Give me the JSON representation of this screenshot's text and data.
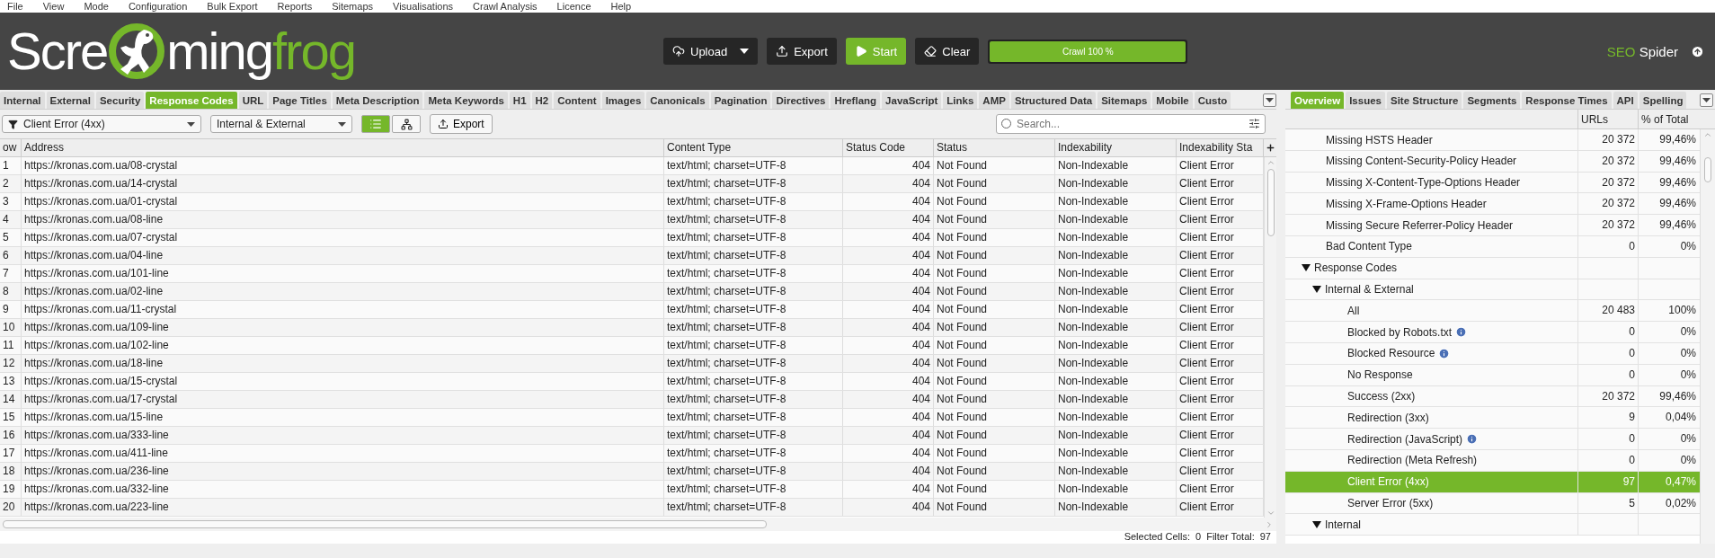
{
  "menu": [
    "File",
    "View",
    "Mode",
    "Configuration",
    "Bulk Export",
    "Reports",
    "Sitemaps",
    "Visualisations",
    "Crawl Analysis",
    "Licence",
    "Help"
  ],
  "logo": {
    "before": "Scre",
    "middle": "ming",
    "after": "frog"
  },
  "header_buttons": [
    {
      "kind": "upload",
      "label": "Upload"
    },
    {
      "kind": "export",
      "label": "Export"
    },
    {
      "kind": "start",
      "label": "Start"
    },
    {
      "kind": "clear",
      "label": "Clear"
    }
  ],
  "progress": {
    "label": "Crawl 100 %",
    "level": 1
  },
  "brand": {
    "accent": "SEO",
    "name": "Spider"
  },
  "tabs": [
    {
      "label": "Internal",
      "selected": false
    },
    {
      "label": "External",
      "selected": false
    },
    {
      "label": "Security",
      "selected": false
    },
    {
      "label": "Response Codes",
      "selected": true
    },
    {
      "label": "URL",
      "selected": false
    },
    {
      "label": "Page Titles",
      "selected": false
    },
    {
      "label": "Meta Description",
      "selected": false
    },
    {
      "label": "Meta Keywords",
      "selected": false
    },
    {
      "label": "H1",
      "selected": false
    },
    {
      "label": "H2",
      "selected": false
    },
    {
      "label": "Content",
      "selected": false
    },
    {
      "label": "Images",
      "selected": false
    },
    {
      "label": "Canonicals",
      "selected": false
    },
    {
      "label": "Pagination",
      "selected": false
    },
    {
      "label": "Directives",
      "selected": false
    },
    {
      "label": "Hreflang",
      "selected": false
    },
    {
      "label": "JavaScript",
      "selected": false
    },
    {
      "label": "Links",
      "selected": false
    },
    {
      "label": "AMP",
      "selected": false
    },
    {
      "label": "Structured Data",
      "selected": false
    },
    {
      "label": "Sitemaps",
      "selected": false
    },
    {
      "label": "Mobile",
      "selected": false
    },
    {
      "label": "Custo",
      "selected": false
    }
  ],
  "toolbar": {
    "filter": "Client Error (4xx)",
    "scope": "Internal & External",
    "views": [
      {
        "kind": "list",
        "selected": true
      },
      {
        "kind": "tree",
        "selected": false
      }
    ],
    "export": "Export",
    "search_placeholder": "Search..."
  },
  "table": {
    "columns": [
      "ow",
      "Address",
      "Content Type",
      "Status Code",
      "Status",
      "Indexability",
      "Indexability Sta"
    ],
    "rows": [
      {
        "row": "1",
        "address": "https://kronas.com.ua/08-crystal",
        "content_type": "text/html; charset=UTF-8",
        "status_code": "404",
        "status": "Not Found",
        "indexability": "Non-Indexable",
        "indexability_status": "Client Error"
      },
      {
        "row": "2",
        "address": "https://kronas.com.ua/14-crystal",
        "content_type": "text/html; charset=UTF-8",
        "status_code": "404",
        "status": "Not Found",
        "indexability": "Non-Indexable",
        "indexability_status": "Client Error"
      },
      {
        "row": "3",
        "address": "https://kronas.com.ua/01-crystal",
        "content_type": "text/html; charset=UTF-8",
        "status_code": "404",
        "status": "Not Found",
        "indexability": "Non-Indexable",
        "indexability_status": "Client Error"
      },
      {
        "row": "4",
        "address": "https://kronas.com.ua/08-line",
        "content_type": "text/html; charset=UTF-8",
        "status_code": "404",
        "status": "Not Found",
        "indexability": "Non-Indexable",
        "indexability_status": "Client Error"
      },
      {
        "row": "5",
        "address": "https://kronas.com.ua/07-crystal",
        "content_type": "text/html; charset=UTF-8",
        "status_code": "404",
        "status": "Not Found",
        "indexability": "Non-Indexable",
        "indexability_status": "Client Error"
      },
      {
        "row": "6",
        "address": "https://kronas.com.ua/04-line",
        "content_type": "text/html; charset=UTF-8",
        "status_code": "404",
        "status": "Not Found",
        "indexability": "Non-Indexable",
        "indexability_status": "Client Error"
      },
      {
        "row": "7",
        "address": "https://kronas.com.ua/101-line",
        "content_type": "text/html; charset=UTF-8",
        "status_code": "404",
        "status": "Not Found",
        "indexability": "Non-Indexable",
        "indexability_status": "Client Error"
      },
      {
        "row": "8",
        "address": "https://kronas.com.ua/02-line",
        "content_type": "text/html; charset=UTF-8",
        "status_code": "404",
        "status": "Not Found",
        "indexability": "Non-Indexable",
        "indexability_status": "Client Error"
      },
      {
        "row": "9",
        "address": "https://kronas.com.ua/11-crystal",
        "content_type": "text/html; charset=UTF-8",
        "status_code": "404",
        "status": "Not Found",
        "indexability": "Non-Indexable",
        "indexability_status": "Client Error"
      },
      {
        "row": "10",
        "address": "https://kronas.com.ua/109-line",
        "content_type": "text/html; charset=UTF-8",
        "status_code": "404",
        "status": "Not Found",
        "indexability": "Non-Indexable",
        "indexability_status": "Client Error"
      },
      {
        "row": "11",
        "address": "https://kronas.com.ua/102-line",
        "content_type": "text/html; charset=UTF-8",
        "status_code": "404",
        "status": "Not Found",
        "indexability": "Non-Indexable",
        "indexability_status": "Client Error"
      },
      {
        "row": "12",
        "address": "https://kronas.com.ua/18-line",
        "content_type": "text/html; charset=UTF-8",
        "status_code": "404",
        "status": "Not Found",
        "indexability": "Non-Indexable",
        "indexability_status": "Client Error"
      },
      {
        "row": "13",
        "address": "https://kronas.com.ua/15-crystal",
        "content_type": "text/html; charset=UTF-8",
        "status_code": "404",
        "status": "Not Found",
        "indexability": "Non-Indexable",
        "indexability_status": "Client Error"
      },
      {
        "row": "14",
        "address": "https://kronas.com.ua/17-crystal",
        "content_type": "text/html; charset=UTF-8",
        "status_code": "404",
        "status": "Not Found",
        "indexability": "Non-Indexable",
        "indexability_status": "Client Error"
      },
      {
        "row": "15",
        "address": "https://kronas.com.ua/15-line",
        "content_type": "text/html; charset=UTF-8",
        "status_code": "404",
        "status": "Not Found",
        "indexability": "Non-Indexable",
        "indexability_status": "Client Error"
      },
      {
        "row": "16",
        "address": "https://kronas.com.ua/333-line",
        "content_type": "text/html; charset=UTF-8",
        "status_code": "404",
        "status": "Not Found",
        "indexability": "Non-Indexable",
        "indexability_status": "Client Error"
      },
      {
        "row": "17",
        "address": "https://kronas.com.ua/411-line",
        "content_type": "text/html; charset=UTF-8",
        "status_code": "404",
        "status": "Not Found",
        "indexability": "Non-Indexable",
        "indexability_status": "Client Error"
      },
      {
        "row": "18",
        "address": "https://kronas.com.ua/236-line",
        "content_type": "text/html; charset=UTF-8",
        "status_code": "404",
        "status": "Not Found",
        "indexability": "Non-Indexable",
        "indexability_status": "Client Error"
      },
      {
        "row": "19",
        "address": "https://kronas.com.ua/332-line",
        "content_type": "text/html; charset=UTF-8",
        "status_code": "404",
        "status": "Not Found",
        "indexability": "Non-Indexable",
        "indexability_status": "Client Error"
      },
      {
        "row": "20",
        "address": "https://kronas.com.ua/223-line",
        "content_type": "text/html; charset=UTF-8",
        "status_code": "404",
        "status": "Not Found",
        "indexability": "Non-Indexable",
        "indexability_status": "Client Error"
      }
    ]
  },
  "status_bar": {
    "selected_label": "Selected Cells:",
    "selected_value": "0",
    "total_label": "Filter Total:",
    "total_value": "97"
  },
  "side_tabs": [
    {
      "label": "Overview",
      "selected": true
    },
    {
      "label": "Issues",
      "selected": false
    },
    {
      "label": "Site Structure",
      "selected": false
    },
    {
      "label": "Segments",
      "selected": false
    },
    {
      "label": "Response Times",
      "selected": false
    },
    {
      "label": "API",
      "selected": false
    },
    {
      "label": "Spelling",
      "selected": false
    }
  ],
  "overview": {
    "columns": [
      "URLs",
      "% of Total"
    ],
    "items": [
      {
        "label": "Missing HSTS Header",
        "urls": "20 372",
        "percent": "99,46%",
        "info": false,
        "selected": false
      },
      {
        "label": "Missing Content-Security-Policy Header",
        "urls": "20 372",
        "percent": "99,46%",
        "info": false,
        "selected": false
      },
      {
        "label": "Missing X-Content-Type-Options Header",
        "urls": "20 372",
        "percent": "99,46%",
        "info": false,
        "selected": false
      },
      {
        "label": "Missing X-Frame-Options Header",
        "urls": "20 372",
        "percent": "99,46%",
        "info": false,
        "selected": false
      },
      {
        "label": "Missing Secure Referrer-Policy Header",
        "urls": "20 372",
        "percent": "99,46%",
        "info": false,
        "selected": false
      },
      {
        "label": "Bad Content Type",
        "urls": "0",
        "percent": "0%",
        "info": false,
        "selected": false
      },
      {
        "label": "Response Codes",
        "expanded": true,
        "selected": false,
        "children": [
          {
            "label": "Internal & External",
            "expanded": true,
            "selected": false,
            "children": [
              {
                "label": "All",
                "urls": "20 483",
                "percent": "100%",
                "info": false,
                "selected": false
              },
              {
                "label": "Blocked by Robots.txt",
                "urls": "0",
                "percent": "0%",
                "info": true,
                "selected": false
              },
              {
                "label": "Blocked Resource",
                "urls": "0",
                "percent": "0%",
                "info": true,
                "selected": false
              },
              {
                "label": "No Response",
                "urls": "0",
                "percent": "0%",
                "info": false,
                "selected": false
              },
              {
                "label": "Success (2xx)",
                "urls": "20 372",
                "percent": "99,46%",
                "info": false,
                "selected": false
              },
              {
                "label": "Redirection (3xx)",
                "urls": "9",
                "percent": "0,04%",
                "info": false,
                "selected": false
              },
              {
                "label": "Redirection (JavaScript)",
                "urls": "0",
                "percent": "0%",
                "info": true,
                "selected": false
              },
              {
                "label": "Redirection (Meta Refresh)",
                "urls": "0",
                "percent": "0%",
                "info": false,
                "selected": false
              },
              {
                "label": "Client Error (4xx)",
                "urls": "97",
                "percent": "0,47%",
                "info": false,
                "selected": true
              },
              {
                "label": "Server Error (5xx)",
                "urls": "5",
                "percent": "0,02%",
                "info": false,
                "selected": false
              }
            ]
          },
          {
            "label": "Internal",
            "expanded": true,
            "selected": false
          }
        ]
      }
    ]
  }
}
